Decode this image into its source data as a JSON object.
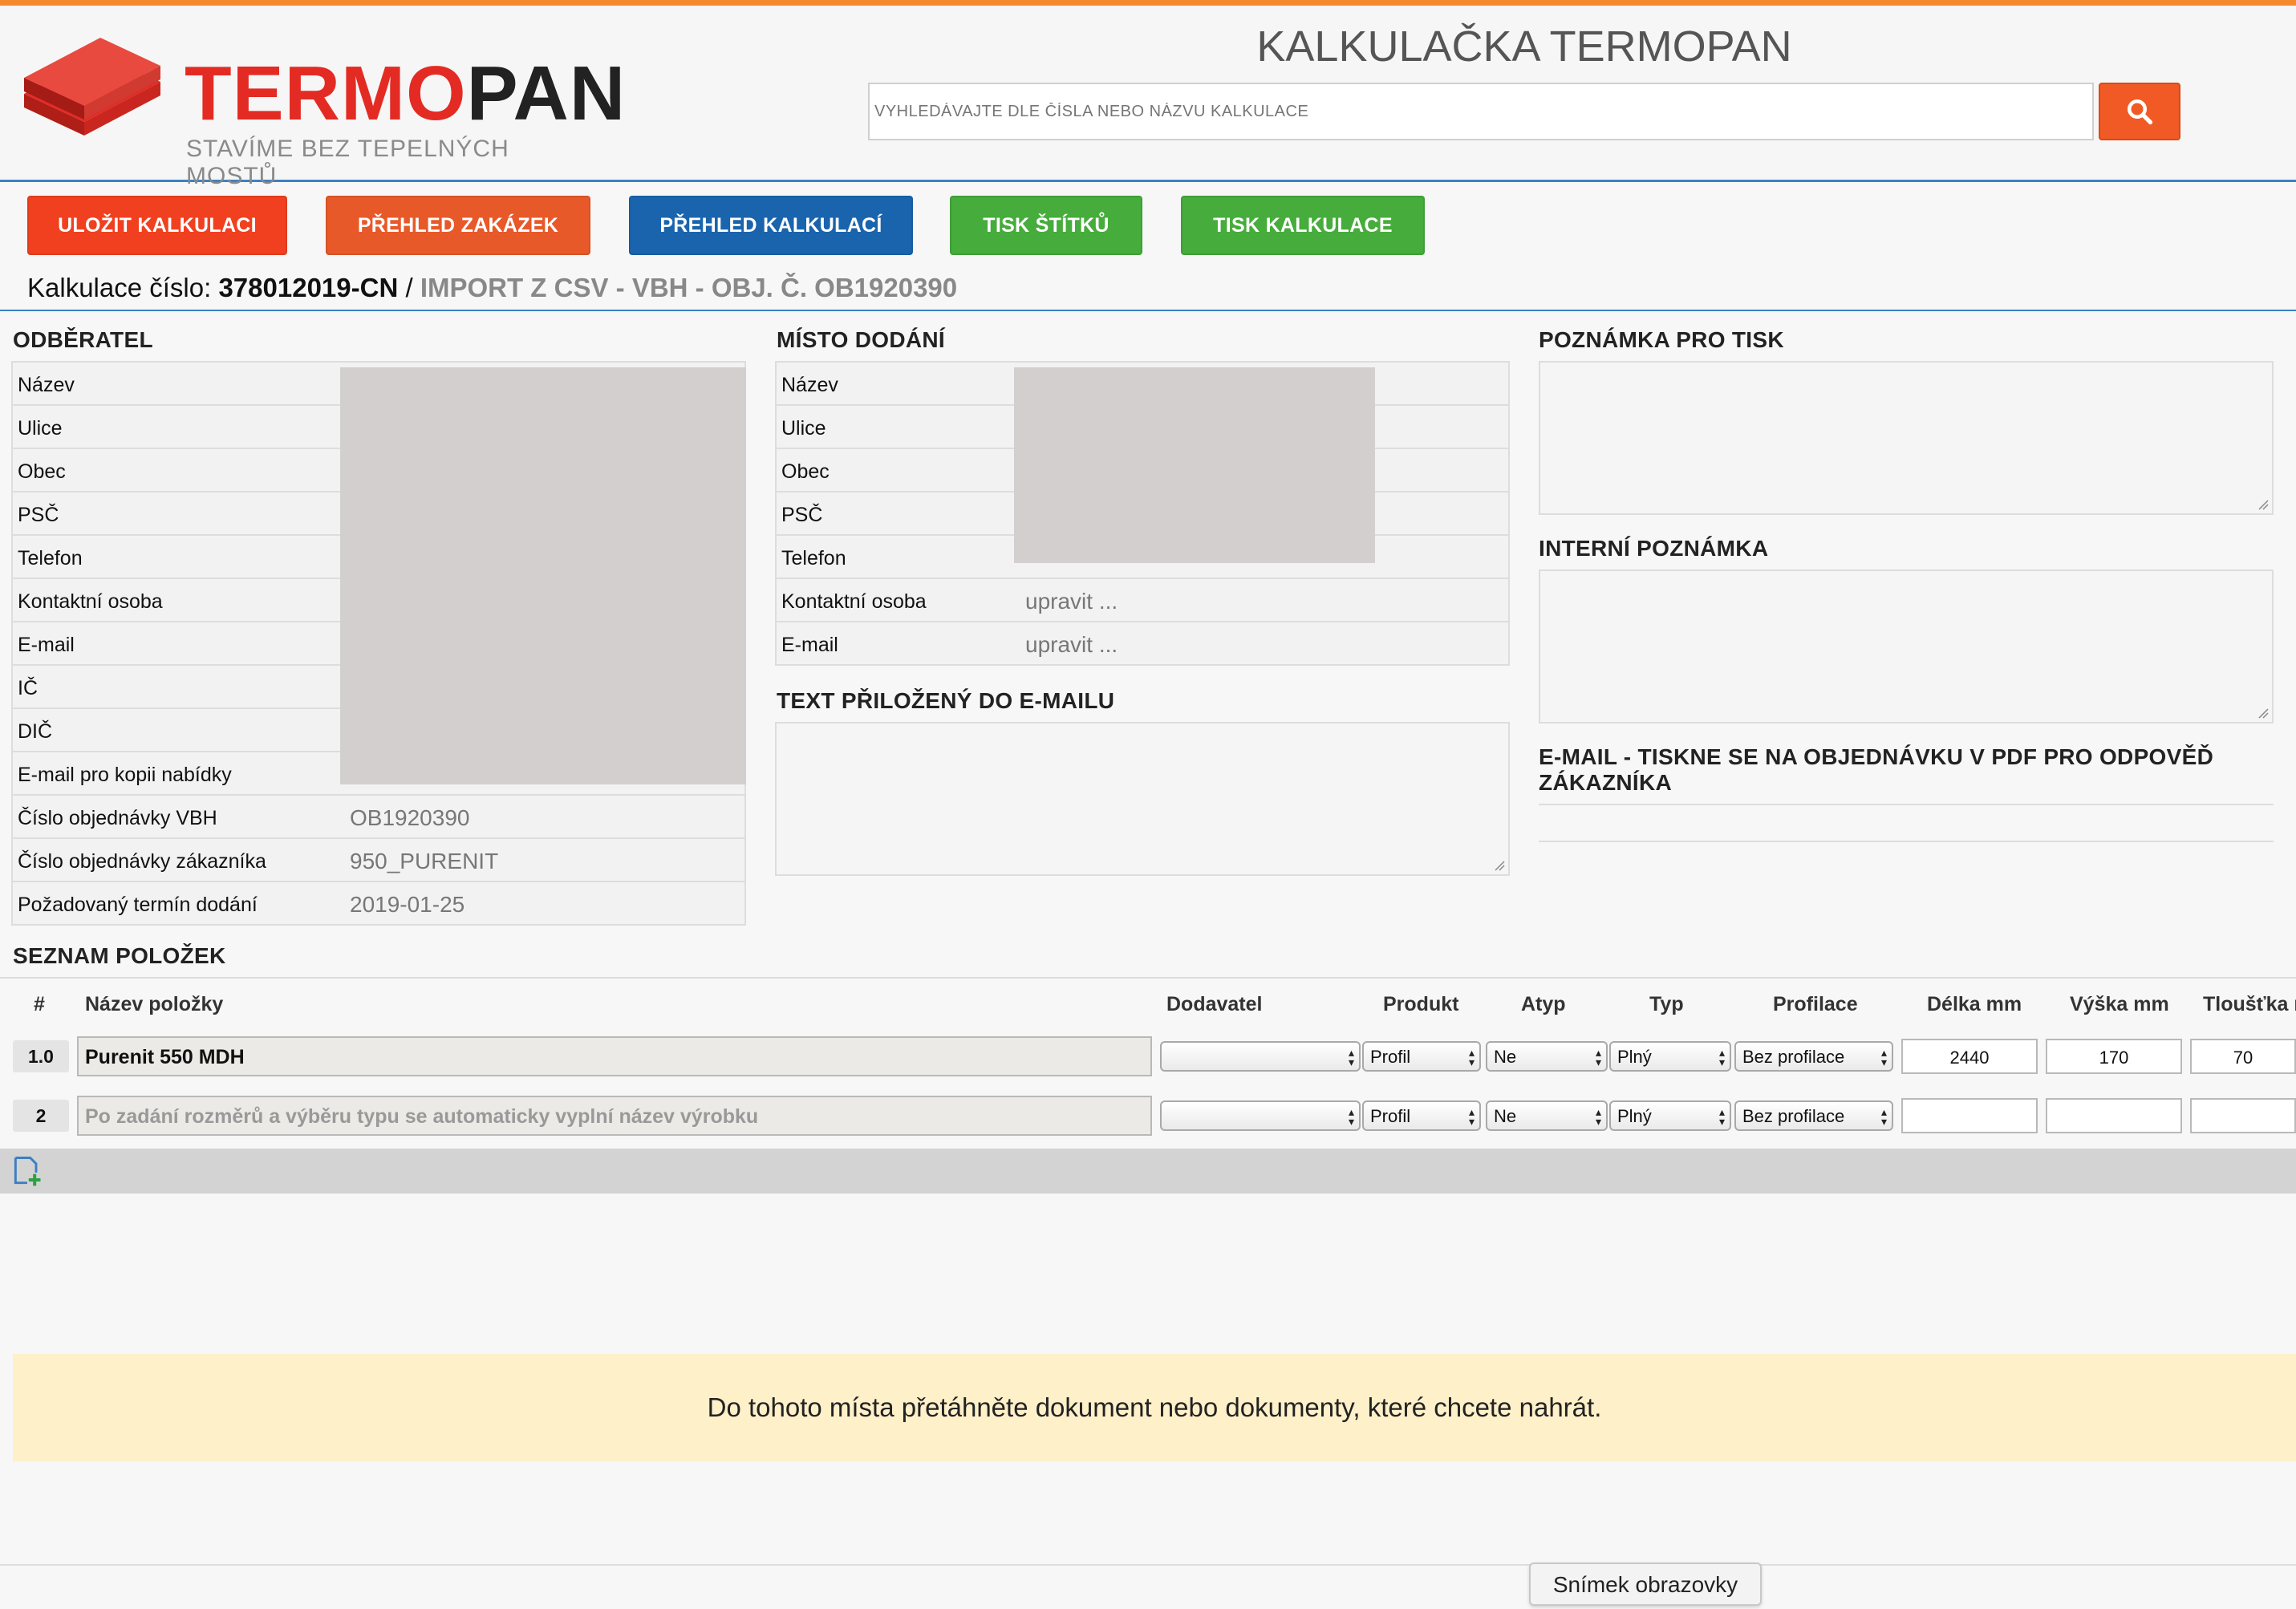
{
  "brand": {
    "name_part1": "TERMO",
    "name_part2": "PAN",
    "tagline": "STAVÍME BEZ TEPELNÝCH MOSTŮ",
    "colors": {
      "accent_orange": "#f58a2c",
      "brand_red": "#e32b24",
      "link_blue": "#3b82c4"
    }
  },
  "header": {
    "title": "KALKULAČKA TERMOPAN",
    "search_placeholder": "VYHLEDÁVAJTE DLE ČÍSLA NEBO NÁZVU KALKULACE",
    "search_icon": "search-icon"
  },
  "toolbar": {
    "save": "ULOŽIT KALKULACI",
    "orders": "PŘEHLED ZAKÁZEK",
    "calculations": "PŘEHLED KALKULACÍ",
    "print_labels": "TISK ŠTÍTKŮ",
    "print_calc": "TISK KALKULACE"
  },
  "calculation": {
    "label": "Kalkulace číslo: ",
    "number": "378012019-CN",
    "separator": " / ",
    "source": "IMPORT Z CSV - VBH - OBJ. Č. OB1920390"
  },
  "customer": {
    "title": "ODBĚRATEL",
    "rows": [
      {
        "label": "Název",
        "value": ""
      },
      {
        "label": "Ulice",
        "value": ""
      },
      {
        "label": "Obec",
        "value": ""
      },
      {
        "label": "PSČ",
        "value": ""
      },
      {
        "label": "Telefon",
        "value": ""
      },
      {
        "label": "Kontaktní osoba",
        "value": ""
      },
      {
        "label": "E-mail",
        "value": ""
      },
      {
        "label": "IČ",
        "value": ""
      },
      {
        "label": "DIČ",
        "value": ""
      },
      {
        "label": "E-mail pro kopii nabídky",
        "value": ""
      },
      {
        "label": "Číslo objednávky VBH",
        "value": "OB1920390"
      },
      {
        "label": "Číslo objednávky zákazníka",
        "value": "950_PURENIT"
      },
      {
        "label": "Požadovaný termín dodání",
        "value": "2019-01-25"
      }
    ]
  },
  "delivery": {
    "title": "MÍSTO DODÁNÍ",
    "rows": [
      {
        "label": "Název",
        "value": ""
      },
      {
        "label": "Ulice",
        "value": ""
      },
      {
        "label": "Obec",
        "value": ""
      },
      {
        "label": "PSČ",
        "value": ""
      },
      {
        "label": "Telefon",
        "value": ""
      },
      {
        "label": "Kontaktní osoba",
        "value": "upravit ..."
      },
      {
        "label": "E-mail",
        "value": "upravit ..."
      }
    ]
  },
  "email_text": {
    "title": "TEXT PŘILOŽENÝ DO E-MAILU",
    "value": ""
  },
  "notes": {
    "print_title": "POZNÁMKA PRO TISK",
    "internal_title": "INTERNÍ POZNÁMKA",
    "email_title": "E-MAIL - TISKNE SE NA OBJEDNÁVKU V PDF PRO ODPOVĚĎ ZÁKAZNÍKA"
  },
  "items": {
    "title": "SEZNAM POLOŽEK",
    "columns": {
      "num": "#",
      "name": "Název položky",
      "supplier": "Dodavatel",
      "product": "Produkt",
      "atyp": "Atyp",
      "type": "Typ",
      "profile": "Profilace",
      "length": "Délka mm",
      "height": "Výška mm",
      "thickness": "Tloušťka mm"
    },
    "rows": [
      {
        "num": "1.0",
        "name": "Purenit 550 MDH",
        "supplier": "",
        "product": "Profil",
        "atyp": "Ne",
        "type": "Plný",
        "profile": "Bez profilace",
        "length": "2440",
        "height": "170",
        "thickness": "70"
      },
      {
        "num": "2",
        "name": "",
        "name_placeholder": "Po zadání rozměrů a výběru typu se automaticky vyplní název výrobku",
        "supplier": "",
        "product": "Profil",
        "atyp": "Ne",
        "type": "Plný",
        "profile": "Bez profilace",
        "length": "",
        "height": "",
        "thickness": ""
      }
    ],
    "add_icon": "add-item-icon"
  },
  "dropzone": {
    "text": "Do tohoto místa přetáhněte dokument nebo dokumenty, které chcete nahrát."
  },
  "tooltip": {
    "text": "Snímek obrazovky"
  }
}
